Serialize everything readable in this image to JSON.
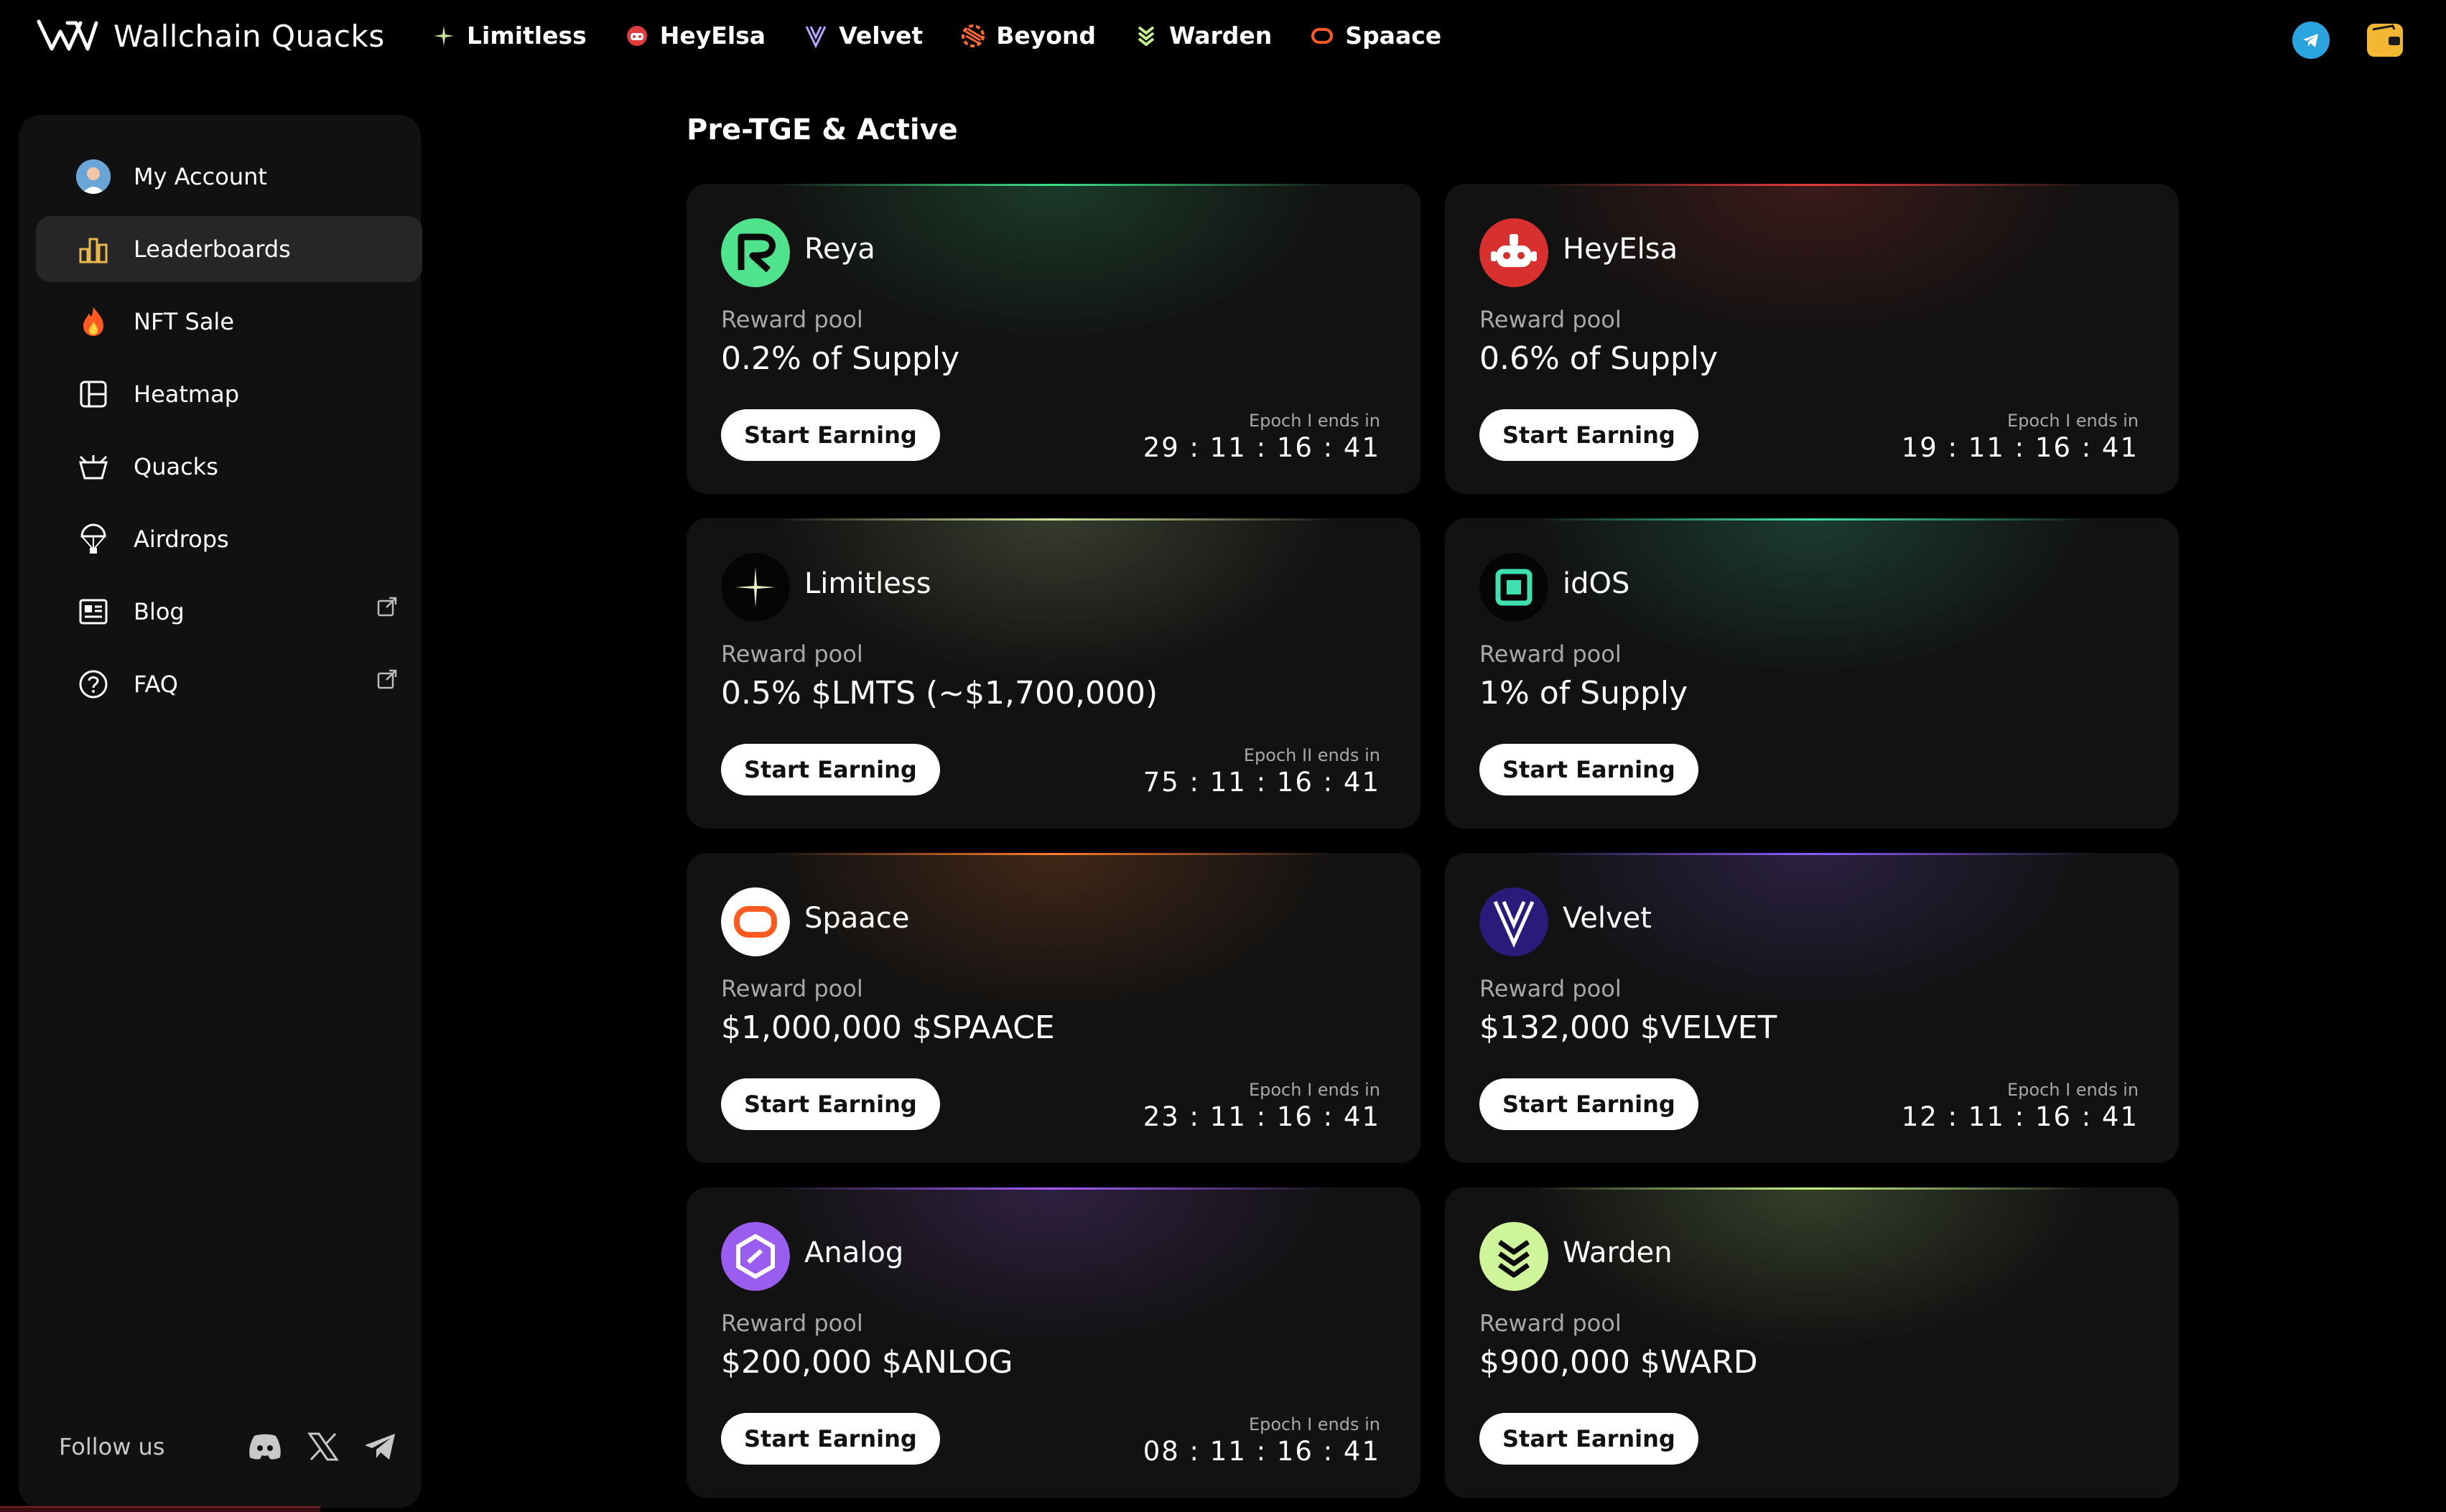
{
  "brand": {
    "name": "Wallchain Quacks"
  },
  "nav": [
    {
      "label": "Limitless",
      "icon": "limitless-spark-icon",
      "color": "#c9e39a"
    },
    {
      "label": "HeyElsa",
      "icon": "heyelsa-robot-icon",
      "color": "#e23b3b"
    },
    {
      "label": "Velvet",
      "icon": "velvet-v-icon",
      "color": "#9d7cff"
    },
    {
      "label": "Beyond",
      "icon": "beyond-stripes-icon",
      "color": "#ff6a2a"
    },
    {
      "label": "Warden",
      "icon": "warden-chevron-icon",
      "color": "#c6f28a"
    },
    {
      "label": "Spaace",
      "icon": "spaace-ring-icon",
      "color": "#ff5a1f"
    }
  ],
  "sidebar": {
    "items": [
      {
        "label": "My Account",
        "icon": "avatar"
      },
      {
        "label": "Leaderboards",
        "icon": "bar-chart-icon",
        "active": true
      },
      {
        "label": "NFT Sale",
        "icon": "fire-icon"
      },
      {
        "label": "Heatmap",
        "icon": "layout-icon"
      },
      {
        "label": "Quacks",
        "icon": "basket-icon"
      },
      {
        "label": "Airdrops",
        "icon": "parachute-icon"
      },
      {
        "label": "Blog",
        "icon": "newspaper-icon",
        "external": true
      },
      {
        "label": "FAQ",
        "icon": "question-icon",
        "external": true
      }
    ],
    "follow_label": "Follow us"
  },
  "main": {
    "section_title": "Pre-TGE & Active",
    "cards": [
      {
        "name": "Reya",
        "reward_label": "Reward pool",
        "reward": "0.2% of Supply",
        "button": "Start Earning",
        "epoch_label": "Epoch I ends in",
        "epoch_time": "29 : 11 : 16 : 41",
        "accent": "#3ddc84"
      },
      {
        "name": "HeyElsa",
        "reward_label": "Reward pool",
        "reward": "0.6% of Supply",
        "button": "Start Earning",
        "epoch_label": "Epoch I ends in",
        "epoch_time": "19 : 11 : 16 : 41",
        "accent": "#e23b3b"
      },
      {
        "name": "Limitless",
        "reward_label": "Reward pool",
        "reward": "0.5% $LMTS (~$1,700,000)",
        "button": "Start Earning",
        "epoch_label": "Epoch II ends in",
        "epoch_time": "75 : 11 : 16 : 41",
        "accent": "#c9e39a"
      },
      {
        "name": "idOS",
        "reward_label": "Reward pool",
        "reward": "1% of Supply",
        "button": "Start Earning",
        "epoch_label": "",
        "epoch_time": "",
        "accent": "#3fe0b0"
      },
      {
        "name": "Spaace",
        "reward_label": "Reward pool",
        "reward": "$1,000,000 $SPAACE",
        "button": "Start Earning",
        "epoch_label": "Epoch I ends in",
        "epoch_time": "23 : 11 : 16 : 41",
        "accent": "#ff7a2a"
      },
      {
        "name": "Velvet",
        "reward_label": "Reward pool",
        "reward": "$132,000 $VELVET",
        "button": "Start Earning",
        "epoch_label": "Epoch I ends in",
        "epoch_time": "12 : 11 : 16 : 41",
        "accent": "#8a5cff"
      },
      {
        "name": "Analog",
        "reward_label": "Reward pool",
        "reward": "$200,000 $ANLOG",
        "button": "Start Earning",
        "epoch_label": "Epoch I ends in",
        "epoch_time": "08 : 11 : 16 : 41",
        "accent": "#a45cff"
      },
      {
        "name": "Warden",
        "reward_label": "Reward pool",
        "reward": "$900,000 $WARD",
        "button": "Start Earning",
        "epoch_label": "",
        "epoch_time": "",
        "accent": "#c6f28a"
      }
    ]
  }
}
